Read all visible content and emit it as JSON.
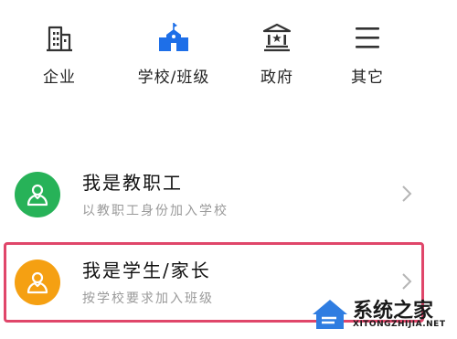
{
  "top_tabs": [
    {
      "label": "企业",
      "icon": "building-icon"
    },
    {
      "label": "学校/班级",
      "icon": "school-icon",
      "active": true
    },
    {
      "label": "政府",
      "icon": "government-icon"
    },
    {
      "label": "其它",
      "icon": "menu-icon"
    }
  ],
  "roles": [
    {
      "title": "我是教职工",
      "subtitle": "以教职工身份加入学校",
      "icon": "user-icon",
      "color": "#27b258"
    },
    {
      "title": "我是学生/家长",
      "subtitle": "按学校要求加入班级",
      "icon": "user-icon",
      "color": "#f5a012",
      "highlighted": true
    }
  ],
  "watermark": {
    "name": "系统之家",
    "url": "XITONGZHIJIA.NET"
  },
  "colors": {
    "accent_blue": "#1e6fe8",
    "staff_green": "#27b258",
    "student_orange": "#f5a012",
    "highlight_red": "#e0466a"
  }
}
